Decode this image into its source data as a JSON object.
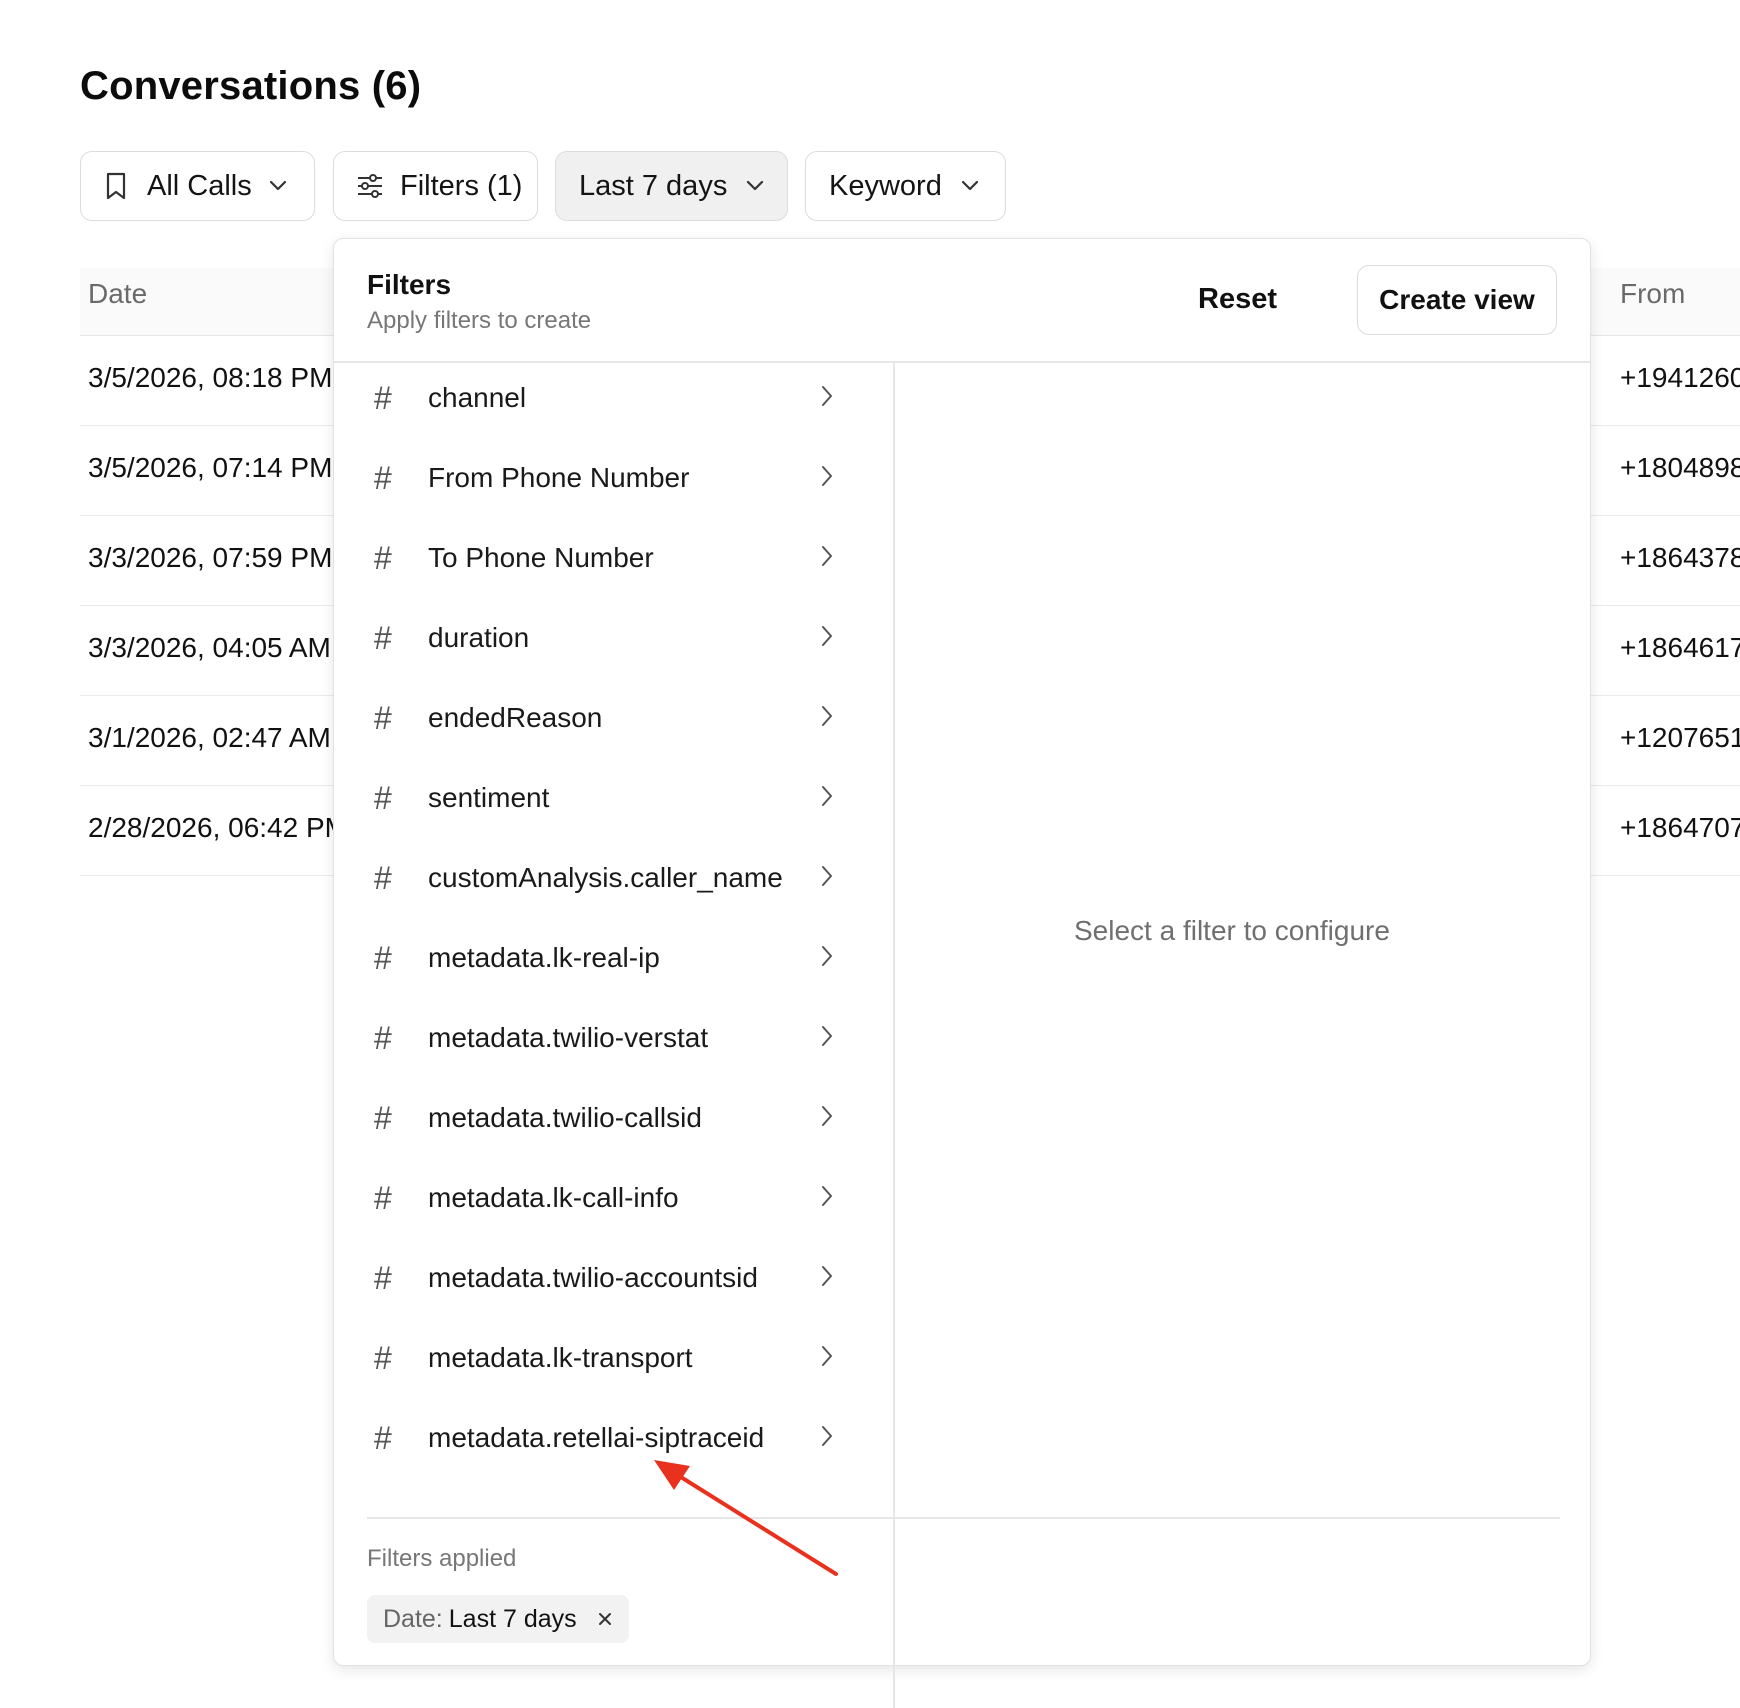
{
  "page": {
    "title": "Conversations (6)"
  },
  "toolbar": {
    "all_calls": "All Calls",
    "filters": "Filters (1)",
    "date_range": "Last 7 days",
    "keyword": "Keyword"
  },
  "table": {
    "columns": {
      "date": "Date",
      "from": "From"
    },
    "rows": [
      {
        "date": "3/5/2026, 08:18 PM",
        "from": "+1941260"
      },
      {
        "date": "3/5/2026, 07:14 PM",
        "from": "+1804898"
      },
      {
        "date": "3/3/2026, 07:59 PM",
        "from": "+1864378"
      },
      {
        "date": "3/3/2026, 04:05 AM",
        "from": "+1864617"
      },
      {
        "date": "3/1/2026, 02:47 AM",
        "from": "+1207651"
      },
      {
        "date": "2/28/2026, 06:42 PM",
        "from": "+1864707"
      }
    ]
  },
  "filters_panel": {
    "title": "Filters",
    "subtitle": "Apply filters to create",
    "reset": "Reset",
    "create_view": "Create view",
    "items": [
      "channel",
      "From Phone Number",
      "To Phone Number",
      "duration",
      "endedReason",
      "sentiment",
      "customAnalysis.caller_name",
      "metadata.lk-real-ip",
      "metadata.twilio-verstat",
      "metadata.twilio-callsid",
      "metadata.lk-call-info",
      "metadata.twilio-accountsid",
      "metadata.lk-transport",
      "metadata.retellai-siptraceid"
    ],
    "item_icon": "#",
    "placeholder": "Select a filter to configure",
    "applied_title": "Filters applied",
    "applied_chip": {
      "key": "Date:",
      "value": "Last 7 days"
    }
  },
  "annotation": {
    "color": "#e8321e"
  }
}
